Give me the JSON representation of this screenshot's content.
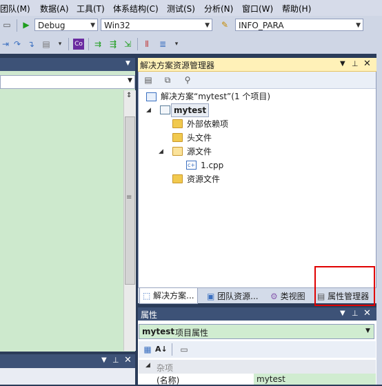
{
  "menu": [
    "团队(M)",
    "数据(A)",
    "工具(T)",
    "体系结构(C)",
    "测试(S)",
    "分析(N)",
    "窗口(W)",
    "帮助(H)"
  ],
  "toolbar": {
    "config_value": "Debug",
    "platform_value": "Win32",
    "find_value": "INFO_PARA"
  },
  "solution_explorer": {
    "title": "解决方案资源管理器",
    "solution_label": "解决方案“mytest”(1 个项目)",
    "project": "mytest",
    "items": [
      "外部依赖项",
      "头文件",
      "源文件",
      "1.cpp",
      "资源文件"
    ]
  },
  "tabs": [
    "解决方案...",
    "团队资源...",
    "类视图",
    "属性管理器"
  ],
  "properties": {
    "title": "属性",
    "object_name": "mytest",
    "object_type": "项目属性",
    "category": "杂项",
    "row_name": "(名称)",
    "row_value": "mytest"
  },
  "colors": {
    "highlight": "#e00000",
    "panel_header": "#3d5277",
    "active_header": "#fff1b8",
    "editor_bg": "#cde9cd"
  }
}
